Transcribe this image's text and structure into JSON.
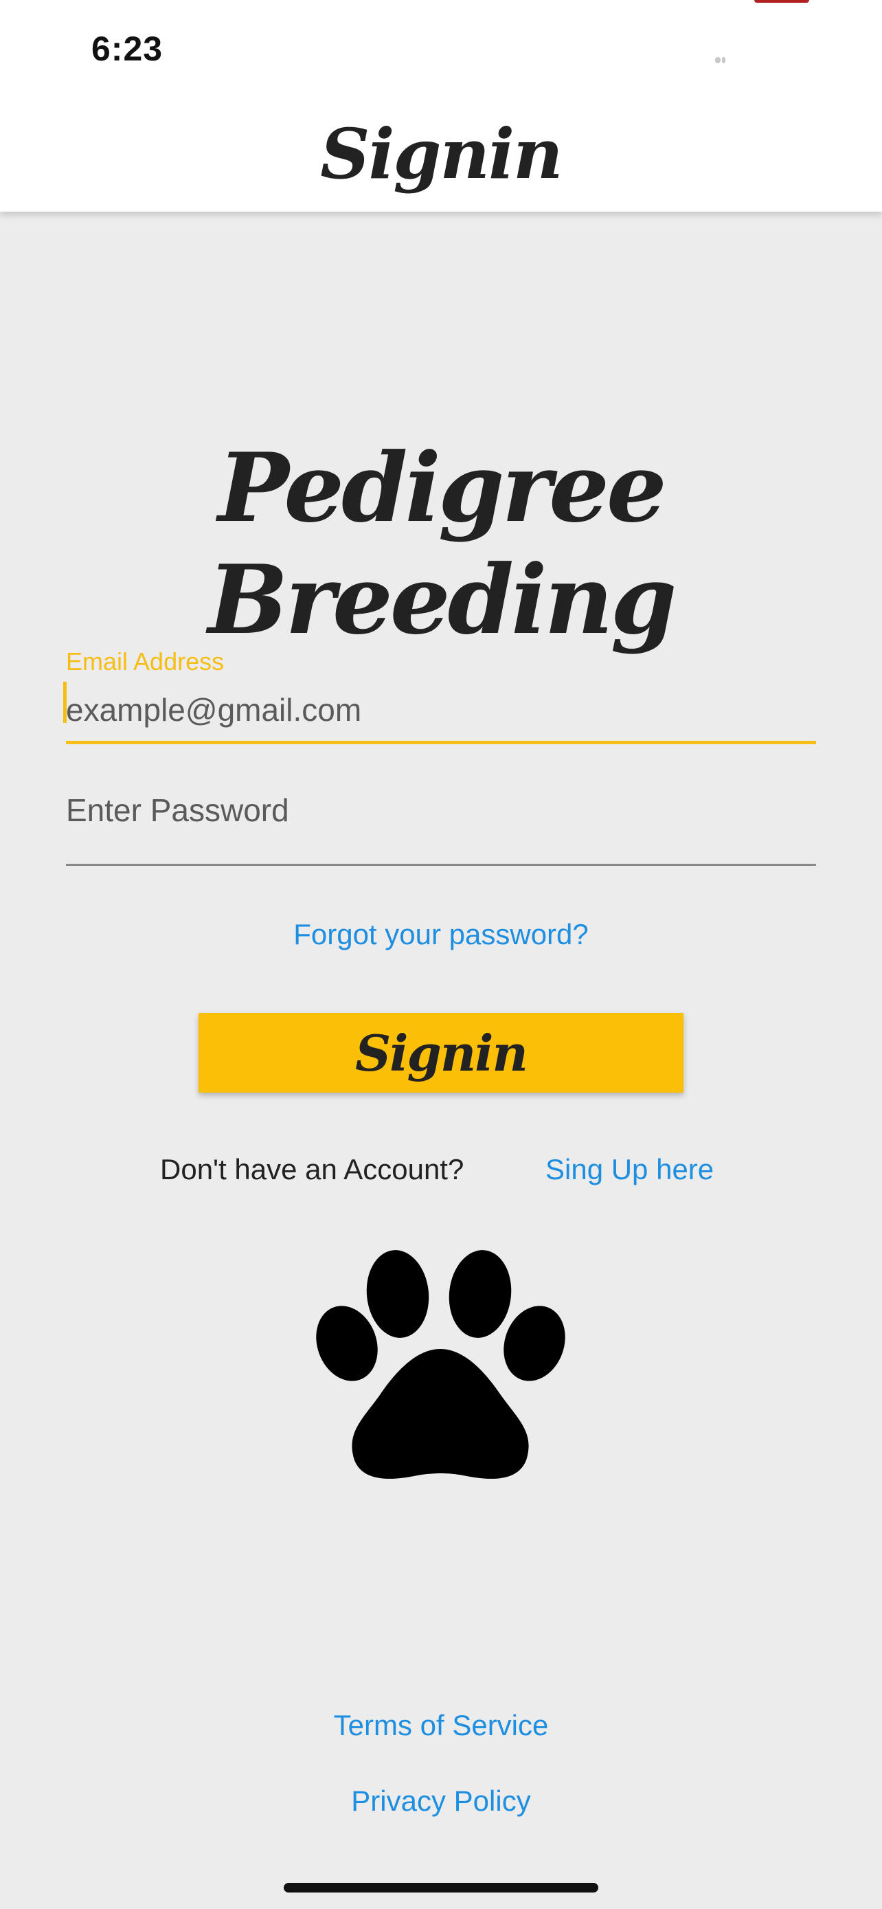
{
  "status_bar": {
    "time": "6:23"
  },
  "header": {
    "title": "Signin"
  },
  "app": {
    "title": "Pedigree Breeding"
  },
  "form": {
    "email_label": "Email Address",
    "email_placeholder": "example@gmail.com",
    "password_placeholder": "Enter Password",
    "forgot_link": "Forgot your password?",
    "signin_button": "Signin"
  },
  "signup": {
    "prompt": "Don't have an Account?",
    "link": "Sing Up here"
  },
  "footer": {
    "terms": "Terms of Service",
    "privacy": "Privacy Policy"
  },
  "icons": {
    "logo": "paw-icon"
  },
  "colors": {
    "accent": "#fcbf07",
    "link": "#1e8fe0",
    "background": "#ececec"
  }
}
